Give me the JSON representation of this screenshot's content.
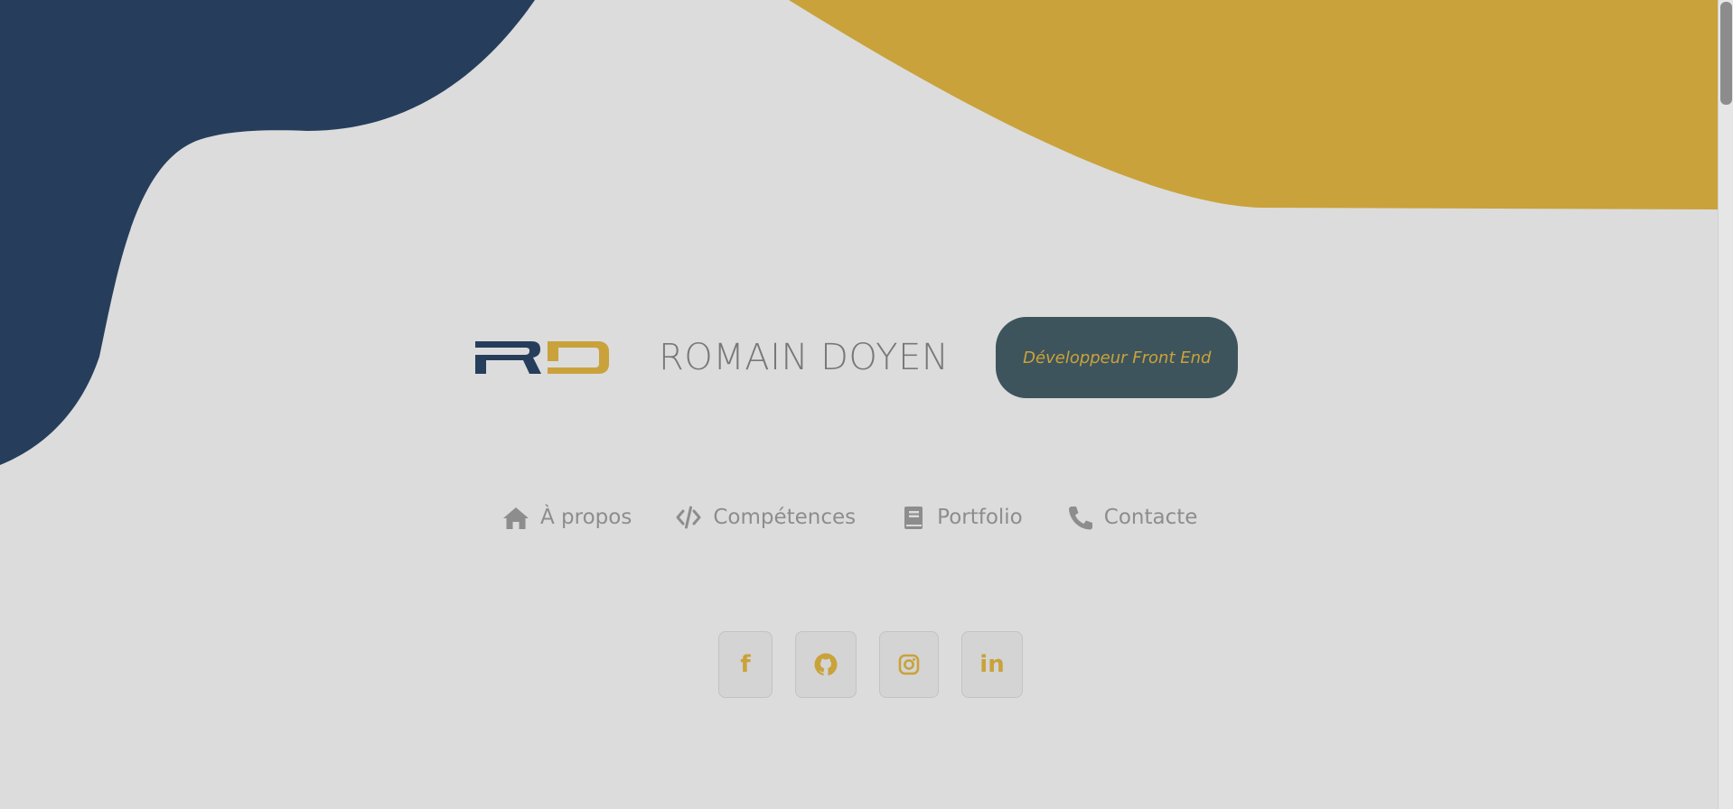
{
  "colors": {
    "background": "#dcdcdc",
    "navy_blob": "#263e5b",
    "gold_blob": "#c9a23b",
    "badge_background": "#3d545c",
    "accent": "#c9a23a",
    "text_muted": "#8d8d8d"
  },
  "header": {
    "logo_letters": "RD",
    "name": "ROMAIN DOYEN",
    "role": "Développeur Front End"
  },
  "nav": {
    "items": [
      {
        "label": "À propos",
        "icon": "home-icon"
      },
      {
        "label": "Compétences",
        "icon": "code-icon"
      },
      {
        "label": "Portfolio",
        "icon": "book-icon"
      },
      {
        "label": "Contacte",
        "icon": "phone-icon"
      }
    ]
  },
  "socials": {
    "items": [
      {
        "glyph": "f",
        "icon": "facebook-icon"
      },
      {
        "glyph": "",
        "icon": "github-icon"
      },
      {
        "glyph": "",
        "icon": "instagram-icon"
      },
      {
        "glyph": "in",
        "icon": "linkedin-icon"
      }
    ]
  }
}
